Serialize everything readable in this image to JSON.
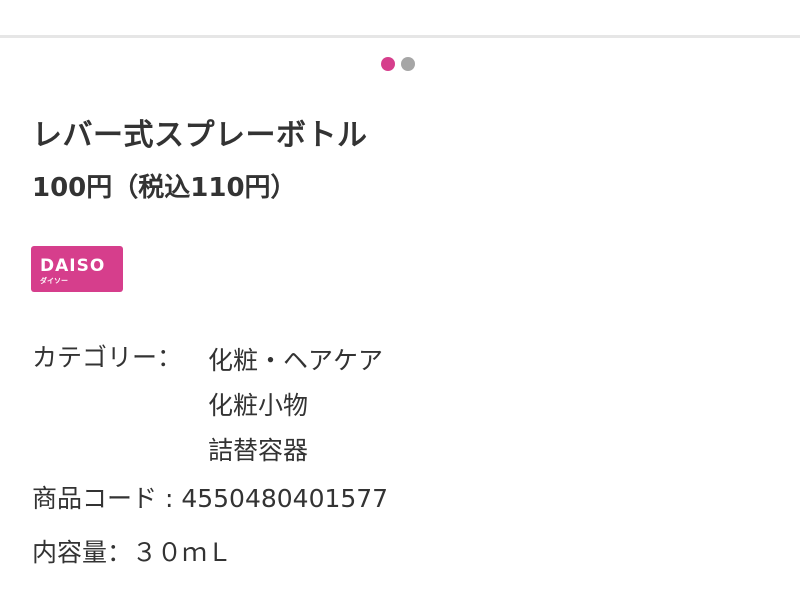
{
  "carousel": {
    "dots": [
      {
        "state": "active",
        "color": "#d63e8c"
      },
      {
        "state": "inactive",
        "color": "#a6a6a6"
      }
    ]
  },
  "product": {
    "title": "レバー式スプレーボトル",
    "price": "100円（税込110円）",
    "brand": {
      "logo_text": "DAISO",
      "logo_subtext": "ダイソー",
      "color": "#d63e8c"
    },
    "category_label": "カテゴリー：",
    "categories": [
      "化粧・ヘアケア",
      "化粧小物",
      "詰替容器"
    ],
    "code_line": "商品コード : 4550480401577",
    "volume_line": "内容量：３０ｍＬ"
  }
}
